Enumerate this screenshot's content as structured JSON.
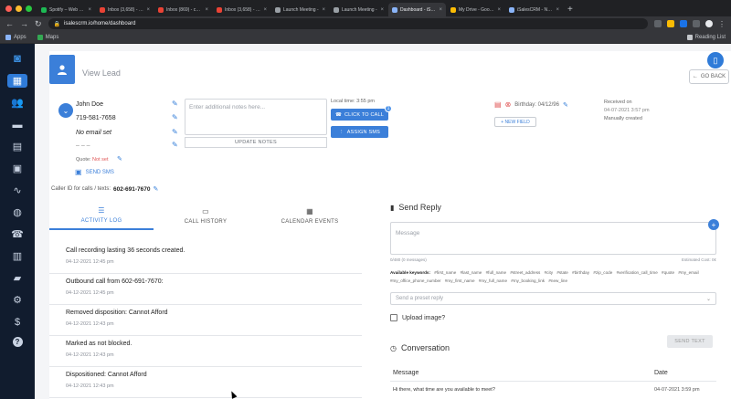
{
  "browser": {
    "tabs": [
      {
        "label": "Spotify – Web Pl...",
        "color": "#1db954"
      },
      {
        "label": "Inbox (3,658) - je...",
        "color": "#ea4335"
      },
      {
        "label": "Inbox (869) - carl...",
        "color": "#ea4335"
      },
      {
        "label": "Inbox (3,658) - ee...",
        "color": "#ea4335"
      },
      {
        "label": "Launch Meeting -",
        "color": "#9aa0a6"
      },
      {
        "label": "Launch Meeting -",
        "color": "#9aa0a6"
      },
      {
        "label": "Dashboard - iSale...",
        "color": "#8ab4f8"
      },
      {
        "label": "My Drive - Google...",
        "color": "#fbbc04"
      },
      {
        "label": "iSalesCRM - New ...",
        "color": "#8ab4f8"
      }
    ],
    "active_tab_index": 6,
    "url": "isalescrm.io/home/dashboard",
    "bookmarks": {
      "apps": "Apps",
      "maps": "Maps",
      "reading_list": "Reading List"
    }
  },
  "sidebar": {
    "items": [
      "logo-icon",
      "dashboard-icon",
      "users-icon",
      "chat-icon",
      "inbox-icon",
      "calendar-icon",
      "analytics-icon",
      "globe-icon",
      "phone-icon",
      "clipboard-icon",
      "truck-icon",
      "gear-icon",
      "dollar-icon",
      "help-icon"
    ],
    "active_index": 1
  },
  "lead": {
    "page_title": "View Lead",
    "go_back": "GO BACK",
    "name": "John Doe",
    "phone": "719-581-7658",
    "email": "No email set",
    "extra": "– – –",
    "quote_label": "Quote:",
    "quote_value": "Not set",
    "send_sms": "SEND SMS",
    "notes_placeholder": "Enter additional notes here...",
    "update_notes": "UPDATE NOTES",
    "local_time": "Local time: 3:55 pm",
    "click_to_call": "CLICK TO CALL",
    "call_badge": "1",
    "assign_sms": "ASSIGN SMS",
    "birthday": "Birthday: 04/12/96",
    "new_field": "+ NEW FIELD",
    "received_on_label": "Received on",
    "received_on_value": "04-07-2021 3:57 pm",
    "manually_created": "Manually created",
    "caller_id_label": "Caller ID for calls / texts:",
    "caller_id_value": "602-691-7670"
  },
  "tabs": [
    {
      "label": "ACTIVITY LOG",
      "icon": "list-icon"
    },
    {
      "label": "CALL HISTORY",
      "icon": "contact-card-icon"
    },
    {
      "label": "CALENDAR EVENTS",
      "icon": "calendar-icon"
    }
  ],
  "activity": [
    {
      "text": "Call recording lasting 36 seconds created.",
      "date": "04-12-2021 12:45 pm"
    },
    {
      "text": "Outbound call from 602-691-7670:",
      "date": "04-12-2021 12:45 pm"
    },
    {
      "text": "Removed disposition: Cannot Afford",
      "date": "04-12-2021 12:43 pm"
    },
    {
      "text": "Marked as not blocked.",
      "date": "04-12-2021 12:43 pm"
    },
    {
      "text": "Dispositioned: Cannot Afford",
      "date": "04-12-2021 12:43 pm"
    }
  ],
  "reply": {
    "title": "Send Reply",
    "message_placeholder": "Message",
    "counts_left": "0/480 (0 messages)",
    "counts_right": "Estimated Cost: 0¢",
    "keywords_label": "Available keywords:",
    "keywords": [
      "#first_name",
      "#last_name",
      "#full_name",
      "#street_address",
      "#city",
      "#state",
      "#birthday",
      "#zip_code",
      "#verification_call_time",
      "#quote",
      "#my_email",
      "#my_office_phone_number",
      "#my_first_name",
      "#my_full_name",
      "#my_booking_link",
      "#new_line"
    ],
    "preset_placeholder": "Send a preset reply",
    "upload_label": "Upload image?",
    "send_text": "SEND TEXT"
  },
  "conversation": {
    "title": "Conversation",
    "col_message": "Message",
    "col_date": "Date",
    "rows": [
      {
        "message": "Hi there, what time are you available to meet?",
        "date": "04-07-2021 3:59 pm"
      }
    ]
  }
}
